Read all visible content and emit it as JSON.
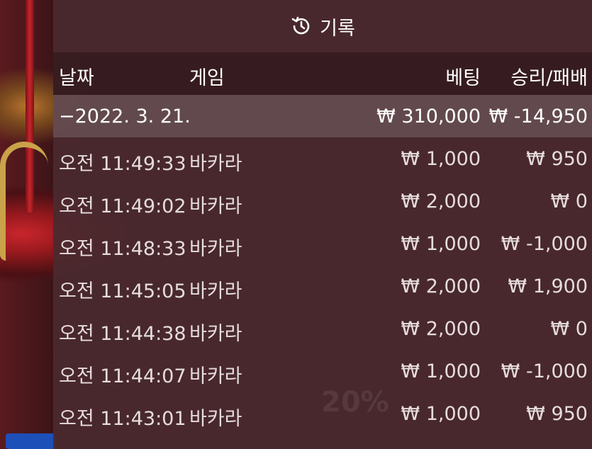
{
  "header": {
    "title": "기록",
    "icon": "history-icon"
  },
  "columns": {
    "date": "날짜",
    "game": "게임",
    "bet": "베팅",
    "win_loss": "승리/패배"
  },
  "date_group": {
    "date": "−2022. 3. 21.",
    "total_bet": "₩ 310,000",
    "total_win_loss": "₩ -14,950"
  },
  "rows": [
    {
      "time": "오전 11:49:33",
      "game": "바카라",
      "bet": "₩ 1,000",
      "win_loss": "₩ 950"
    },
    {
      "time": "오전 11:49:02",
      "game": "바카라",
      "bet": "₩ 2,000",
      "win_loss": "₩ 0"
    },
    {
      "time": "오전 11:48:33",
      "game": "바카라",
      "bet": "₩ 1,000",
      "win_loss": "₩ -1,000"
    },
    {
      "time": "오전 11:45:05",
      "game": "바카라",
      "bet": "₩ 2,000",
      "win_loss": "₩ 1,900"
    },
    {
      "time": "오전 11:44:38",
      "game": "바카라",
      "bet": "₩ 2,000",
      "win_loss": "₩ 0"
    },
    {
      "time": "오전 11:44:07",
      "game": "바카라",
      "bet": "₩ 1,000",
      "win_loss": "₩ -1,000"
    },
    {
      "time": "오전 11:43:01",
      "game": "바카라",
      "bet": "₩ 1,000",
      "win_loss": "₩ 950"
    }
  ],
  "background_text": "20%"
}
